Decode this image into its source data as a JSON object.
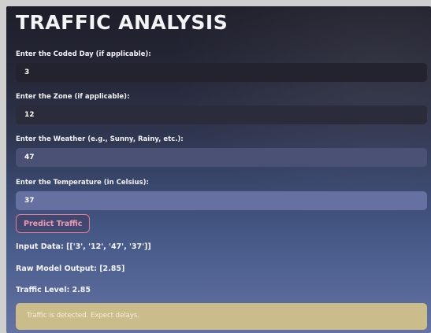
{
  "title": "TRAFFIC ANALYSIS",
  "form": {
    "coded_day": {
      "label": "Enter the Coded Day (if applicable):",
      "value": "3"
    },
    "zone": {
      "label": "Enter the Zone (if applicable):",
      "value": "12"
    },
    "weather": {
      "label": "Enter the Weather (e.g., Sunny, Rainy, etc.):",
      "value": "47"
    },
    "temperature": {
      "label": "Enter the Temperature (in Celsius):",
      "value": "37"
    }
  },
  "predict_button": "Predict Traffic",
  "results": {
    "input_data": "Input Data: [['3', '12', '47', '37']]",
    "raw_output": "Raw Model Output: [2.85]",
    "traffic_level": "Traffic Level: 2.85"
  },
  "alert": {
    "message": "Traffic is detected. Expect delays."
  },
  "colors": {
    "accent": "#e07d97",
    "alert_background": "#cbbd8b"
  }
}
